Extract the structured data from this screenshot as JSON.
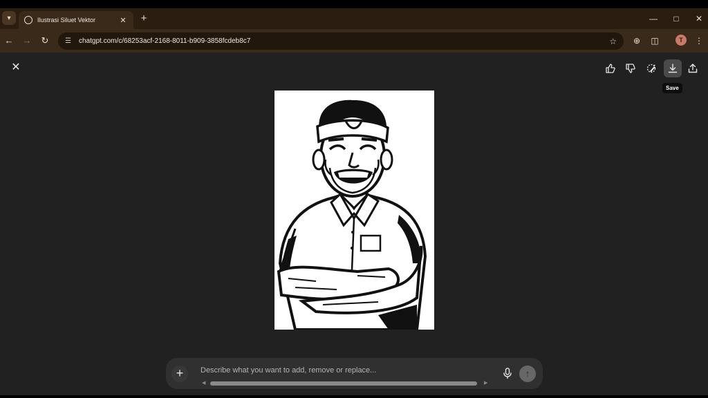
{
  "browser": {
    "tab_title": "Ilustrasi Siluet Vektor",
    "url": "chatgpt.com/c/68253acf-2168-8011-b909-3858fcdeb8c7",
    "profile_initial": "T"
  },
  "viewer": {
    "tooltip": "Save",
    "composer_placeholder": "Describe what you want to add, remove or replace..."
  }
}
